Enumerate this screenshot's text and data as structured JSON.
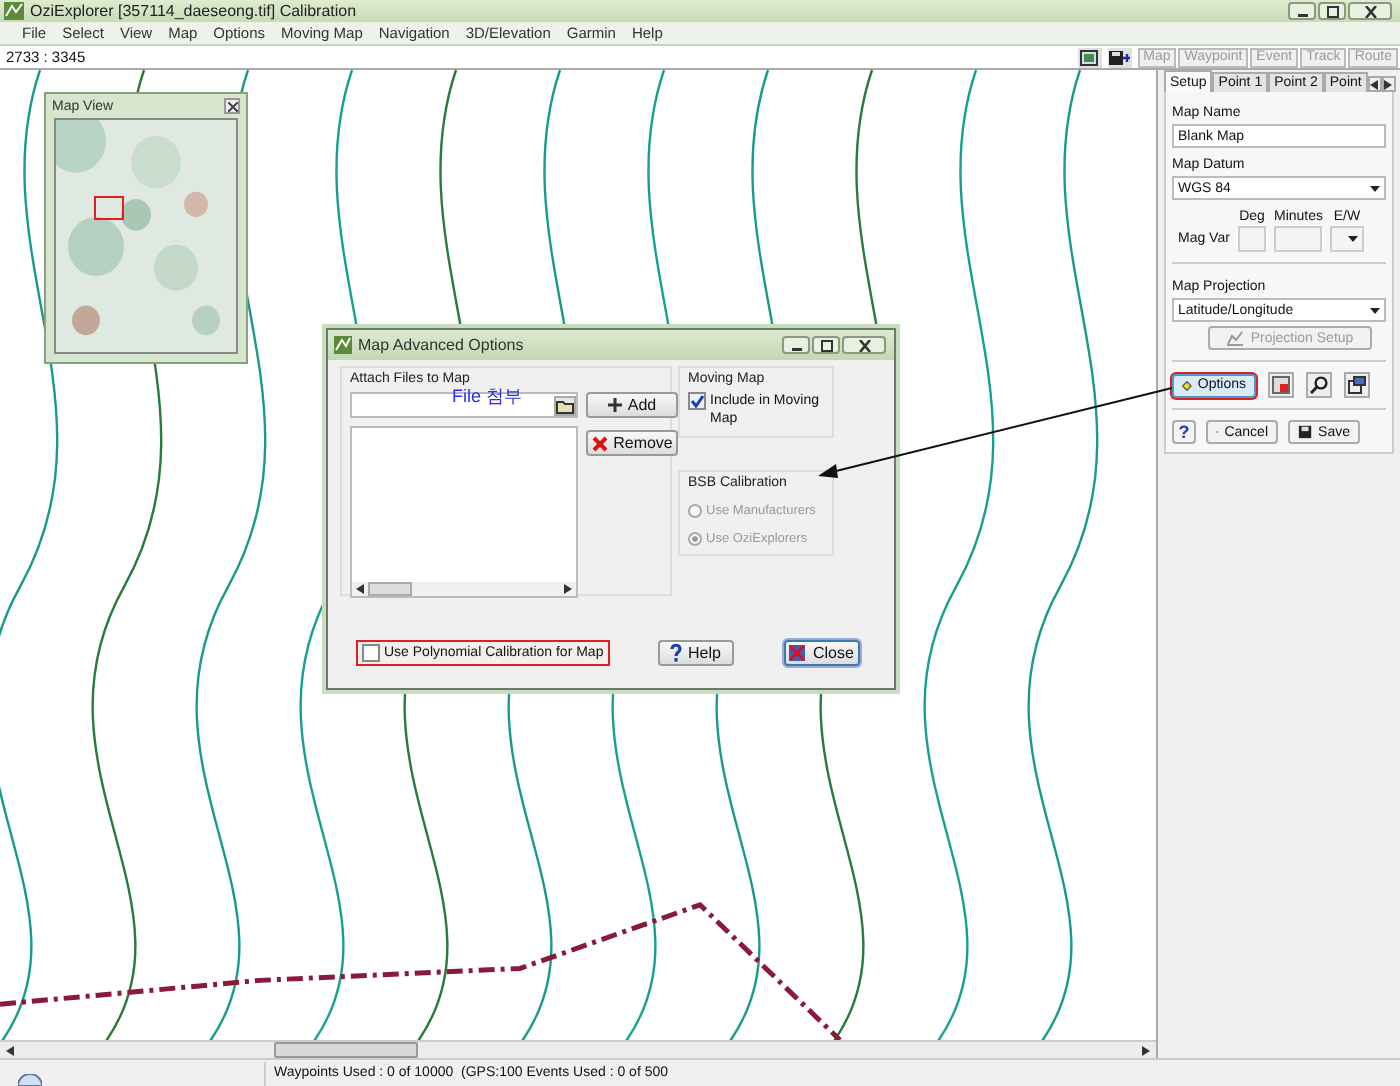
{
  "window": {
    "title": "OziExplorer [357114_daeseong.tif] Calibration"
  },
  "menu": [
    "File",
    "Select",
    "View",
    "Map",
    "Options",
    "Moving Map",
    "Navigation",
    "3D/Elevation",
    "Garmin",
    "Help"
  ],
  "coordinates": "2733 : 3345",
  "toolbar": {
    "buttons": [
      {
        "label": "Map",
        "disabled": true
      },
      {
        "label": "Waypoint",
        "disabled": true
      },
      {
        "label": "Event",
        "disabled": true
      },
      {
        "label": "Track",
        "disabled": true
      },
      {
        "label": "Route",
        "disabled": true
      }
    ]
  },
  "panel": {
    "tabs": [
      {
        "label": "Setup",
        "selected": true
      },
      {
        "label": "Point 1",
        "selected": false
      },
      {
        "label": "Point 2",
        "selected": false
      },
      {
        "label": "Point",
        "selected": false
      }
    ],
    "map_name": {
      "label": "Map Name",
      "value": "Blank Map"
    },
    "map_datum": {
      "label": "Map Datum",
      "value": "WGS 84"
    },
    "mag_var": {
      "label": "Mag Var",
      "columns": [
        "Deg",
        "Minutes",
        "E/W"
      ]
    },
    "map_projection": {
      "label": "Map Projection",
      "value": "Latitude/Longitude"
    },
    "projection_setup": {
      "label": "Projection Setup",
      "disabled": true
    },
    "options": {
      "label": "Options",
      "highlighted": true
    },
    "help": "?",
    "cancel": "Cancel",
    "save": "Save"
  },
  "map_view": {
    "title": "Map View"
  },
  "dialog": {
    "title": "Map Advanced Options",
    "attach": {
      "label": "Attach Files to Map",
      "note": "File 첨부",
      "add": "Add",
      "remove": "Remove"
    },
    "moving_map": {
      "label": "Moving Map",
      "include": {
        "label": "Include in Moving Map",
        "checked": true
      }
    },
    "bsb": {
      "label": "BSB Calibration",
      "disabled": true,
      "options": [
        {
          "label": "Use Manufacturers",
          "selected": false
        },
        {
          "label": "Use OziExplorers",
          "selected": true
        }
      ]
    },
    "polynomial": {
      "label": "Use Polynomial Calibration for Map",
      "checked": false,
      "highlighted": true
    },
    "help": "Help",
    "close": "Close"
  },
  "status_bar": {
    "text": "Waypoints Used : 0 of 10000  (GPS:100 Events Used : 0 of 500"
  }
}
